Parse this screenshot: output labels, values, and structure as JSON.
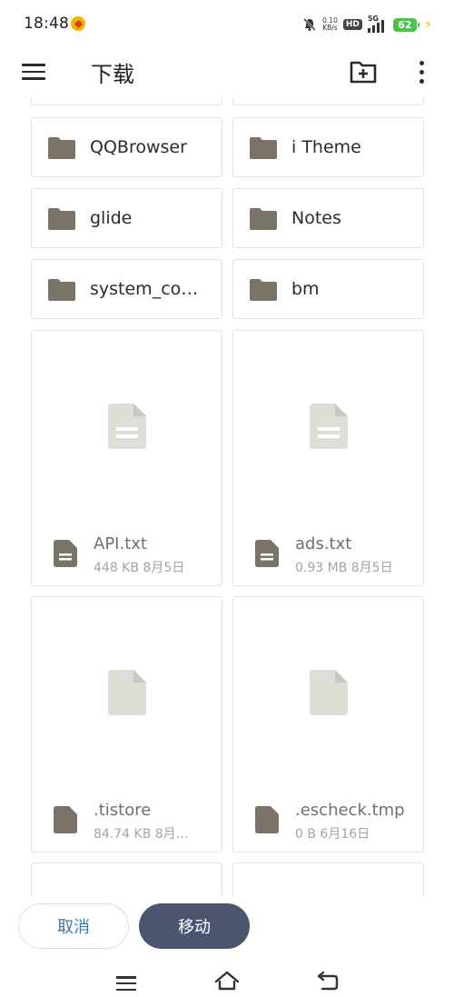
{
  "status_bar": {
    "time": "18:48",
    "net_speed_value": "0.10",
    "net_speed_unit": "KB/s",
    "hd_label": "HD",
    "network_type": "5G",
    "battery_level": "62"
  },
  "app_bar": {
    "title": "下载"
  },
  "folders": [
    {
      "name": "QQBrowser"
    },
    {
      "name": "i Theme"
    },
    {
      "name": "glide"
    },
    {
      "name": "Notes"
    },
    {
      "name": "system_co…"
    },
    {
      "name": "bm"
    }
  ],
  "files": [
    {
      "name": "API.txt",
      "meta": "448 KB 8月5日",
      "icon": "text-file-icon"
    },
    {
      "name": "ads.txt",
      "meta": "0.93 MB 8月5日",
      "icon": "text-file-icon"
    },
    {
      "name": ".tistore",
      "meta": "84.74 KB 8月…",
      "icon": "file-icon"
    },
    {
      "name": ".escheck.tmp",
      "meta": "0 B 6月16日",
      "icon": "file-icon"
    }
  ],
  "actions": {
    "cancel_label": "取消",
    "move_label": "移动"
  },
  "colors": {
    "folder_icon": "#7a7367",
    "thumb_icon": "#deddd6",
    "move_button": "#4c5570",
    "cancel_text": "#3a78a8",
    "battery": "#4cc24a"
  }
}
